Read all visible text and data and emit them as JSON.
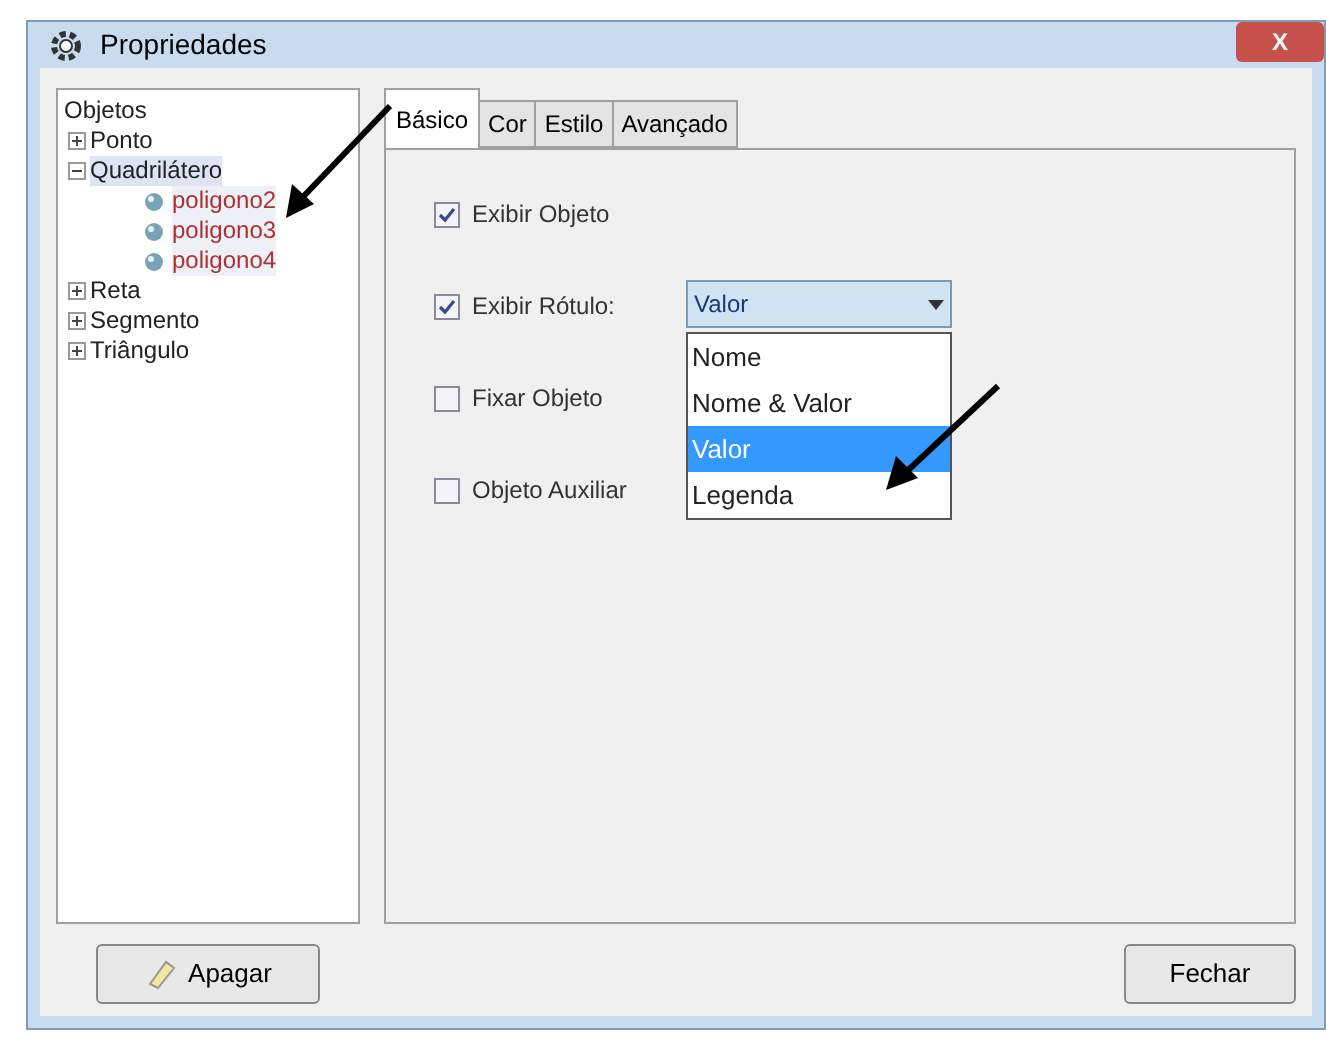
{
  "window": {
    "title": "Propriedades",
    "close_button": "X"
  },
  "tree": {
    "label": "Objetos",
    "children": [
      {
        "label": "Ponto",
        "expanded": false
      },
      {
        "label": "Quadrilátero",
        "expanded": true,
        "children": [
          {
            "label": "poligono2"
          },
          {
            "label": "poligono3"
          },
          {
            "label": "poligono4"
          }
        ]
      },
      {
        "label": "Reta",
        "expanded": false
      },
      {
        "label": "Segmento",
        "expanded": false
      },
      {
        "label": "Triângulo",
        "expanded": false
      }
    ]
  },
  "tabs": [
    {
      "label": "Básico",
      "selected": true
    },
    {
      "label": "Cor",
      "selected": false
    },
    {
      "label": "Estilo",
      "selected": false
    },
    {
      "label": "Avançado",
      "selected": false
    }
  ],
  "options": [
    {
      "label": "Exibir Objeto",
      "checked": true
    },
    {
      "label": "Exibir Rótulo:",
      "checked": true
    },
    {
      "label": "Fixar Objeto",
      "checked": false
    },
    {
      "label": "Objeto Auxiliar",
      "checked": false
    }
  ],
  "label_dropdown": {
    "value": "Valor",
    "items": [
      {
        "label": "Nome",
        "selected": false
      },
      {
        "label": "Nome & Valor",
        "selected": false
      },
      {
        "label": "Valor",
        "selected": true
      },
      {
        "label": "Legenda",
        "selected": false
      }
    ]
  },
  "buttons": {
    "delete": "Apagar",
    "close": "Fechar"
  }
}
